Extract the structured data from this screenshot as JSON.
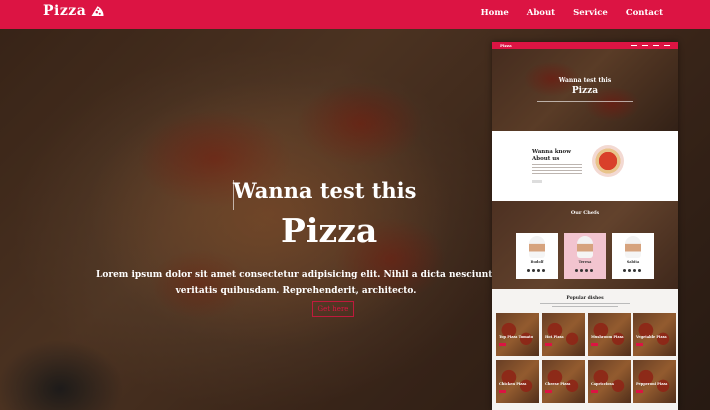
{
  "brand": {
    "name": "Pizza",
    "logo_icon": "pizza-slice-icon",
    "accent_color": "#dc1443"
  },
  "nav": {
    "items": [
      {
        "label": "Home"
      },
      {
        "label": "About"
      },
      {
        "label": "Service"
      },
      {
        "label": "Contact"
      }
    ]
  },
  "hero": {
    "title_small": "Wanna test this",
    "title_big": "Pizza",
    "description_line1": "Lorem ipsum dolor sit amet consectetur adipisicing elit. Nihil a dicta nesciunt nemo e",
    "description_line2": "veritatis quibusdam. Reprehenderit, architecto.",
    "button_label": "Get here"
  },
  "preview": {
    "nav_brand": "Pizza",
    "hero_title_small": "Wanna test this",
    "hero_title_big": "Pizza",
    "about_title": "Wanna know About us",
    "chefs_title": "Our Chefs",
    "chefs": [
      {
        "name": "Rudolf"
      },
      {
        "name": "Teresa"
      },
      {
        "name": "Sabita"
      }
    ],
    "dishes_title": "Popular dishes",
    "dishes": [
      {
        "name": "Top Pizza Tomato"
      },
      {
        "name": "Hot Pizza"
      },
      {
        "name": "Mushroom Pizza"
      },
      {
        "name": "Vegetable Pizza"
      },
      {
        "name": "Chicken Pizza"
      },
      {
        "name": "Cheese Pizza"
      },
      {
        "name": "Capricciosa"
      },
      {
        "name": "Pepperoni Pizza"
      }
    ]
  }
}
